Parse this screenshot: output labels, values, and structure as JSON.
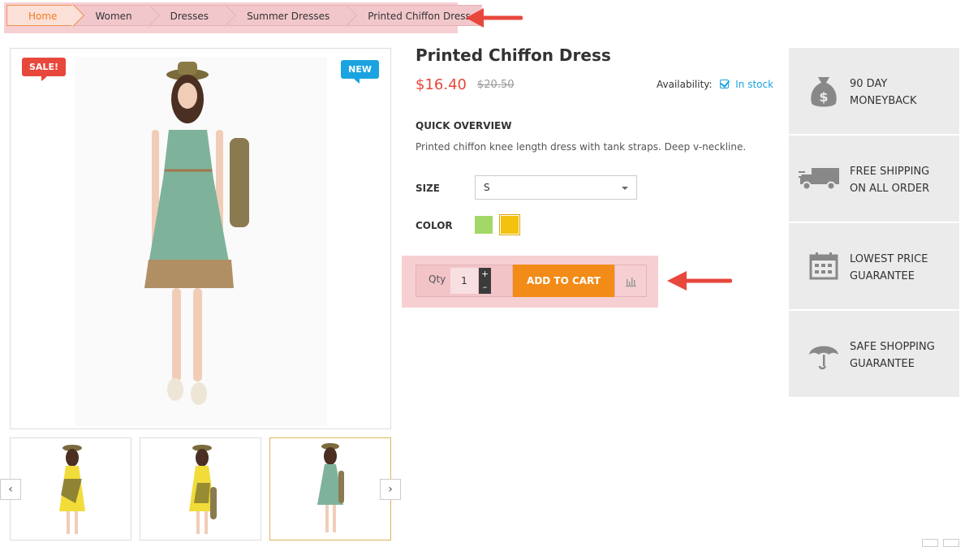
{
  "breadcrumb": {
    "items": [
      "Home",
      "Women",
      "Dresses",
      "Summer Dresses",
      "Printed Chiffon Dress"
    ]
  },
  "product": {
    "badge_sale": "SALE!",
    "badge_new": "NEW",
    "title": "Printed Chiffon Dress",
    "price": "$16.40",
    "old_price": "$20.50",
    "availability_label": "Availability:",
    "availability_value": "In stock",
    "overview_heading": "QUICK OVERVIEW",
    "overview_text": "Printed chiffon knee length dress with tank straps. Deep v-neckline.",
    "size_label": "SIZE",
    "size_value": "S",
    "color_label": "COLOR",
    "colors": [
      "#a3d868",
      "#f2c20f"
    ],
    "qty_label": "Qty",
    "qty_value": "1",
    "add_to_cart": "ADD TO CART"
  },
  "thumbnails": [
    {
      "name": "yellow-dress-front"
    },
    {
      "name": "yellow-dress-side"
    },
    {
      "name": "green-dress-front"
    }
  ],
  "guarantees": [
    {
      "line1": "90 DAY",
      "line2": "MONEYBACK",
      "icon": "money-bag-icon"
    },
    {
      "line1": "FREE SHIPPING",
      "line2": "ON ALL ORDER",
      "icon": "truck-icon"
    },
    {
      "line1": "LOWEST PRICE",
      "line2": "GUARANTEE",
      "icon": "calendar-icon"
    },
    {
      "line1": "SAFE SHOPPING",
      "line2": "GUARANTEE",
      "icon": "umbrella-icon"
    }
  ],
  "colors": {
    "accent_orange": "#f28b17",
    "sale_red": "#e8473c",
    "new_blue": "#1aa3e0",
    "highlight_pink": "#f6cfd3",
    "annotation_arrow": "#e8473c"
  }
}
